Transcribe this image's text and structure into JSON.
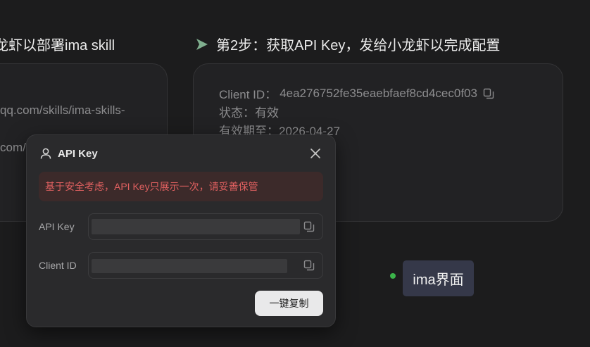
{
  "steps": {
    "step1_title": "龙虾以部署ima skill",
    "step2_title": "第2步：获取API Key，发给小龙虾以完成配置"
  },
  "card1": {
    "url_line1": "qq.com/skills/ima-skills-",
    "url_line2": "com/"
  },
  "card2": {
    "client_id_label": "Client ID：",
    "client_id_value": "4ea276752fe35eaebfaef8cd4cec0f03",
    "status_label": "状态：",
    "status_value": "有效",
    "expiry_label": "有效期至：",
    "expiry_value": "2026-04-27"
  },
  "modal": {
    "title": "API Key",
    "warning": "基于安全考虑，API Key只展示一次，请妥善保管",
    "api_key_label": "API Key",
    "client_id_label": "Client ID",
    "copy_all_label": "一键复制"
  },
  "tag": {
    "label": "ima界面"
  },
  "colors": {
    "background": "#1c1c1d",
    "accent_green": "#3bb34a",
    "warning_red": "#e06060",
    "tag_bg": "#353849"
  },
  "icons": [
    "send-arrow-icon",
    "copy-icon",
    "user-icon",
    "close-icon"
  ]
}
